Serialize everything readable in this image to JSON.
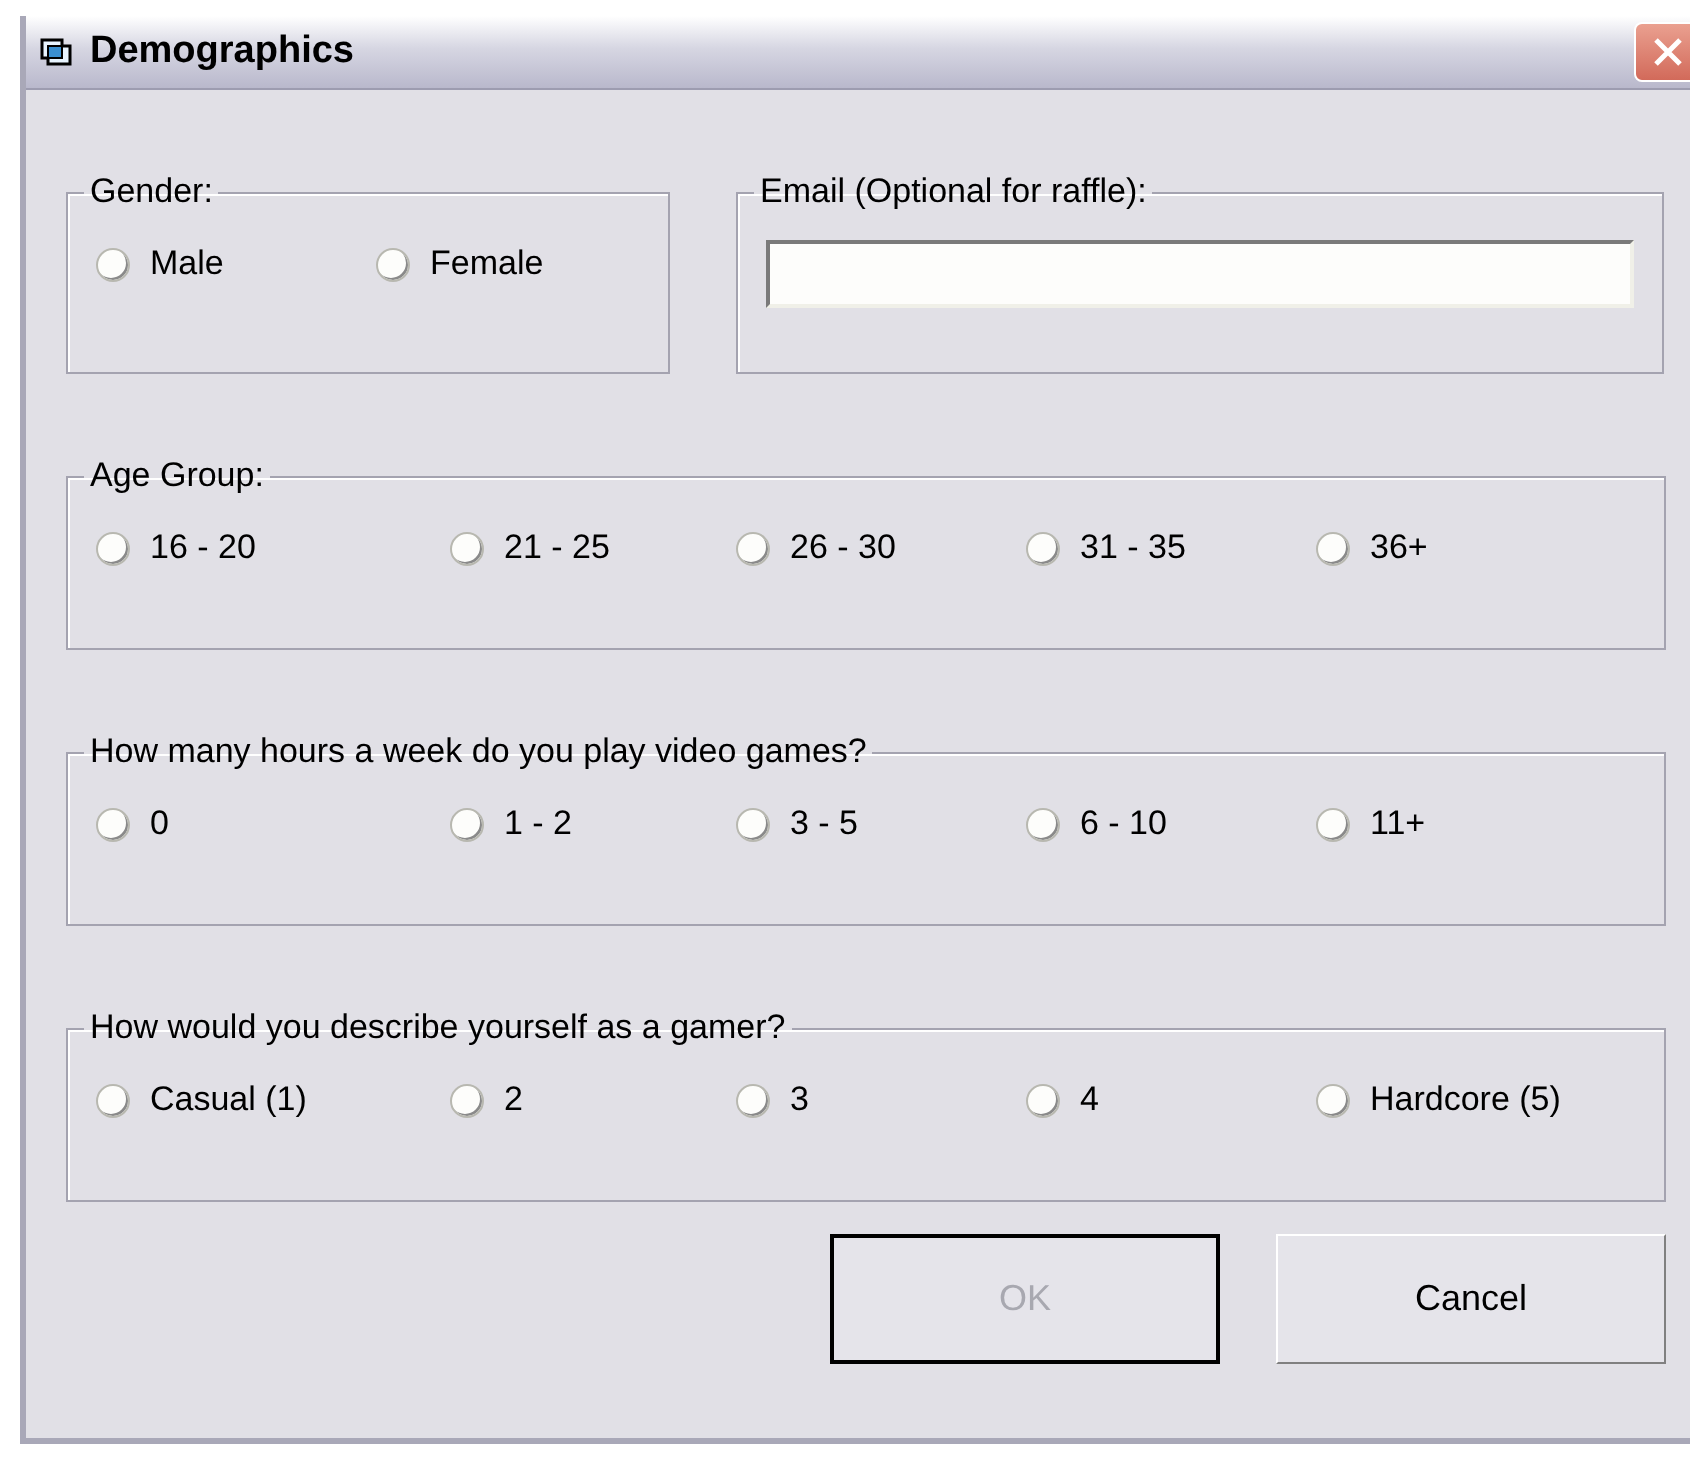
{
  "window": {
    "title": "Demographics"
  },
  "gender": {
    "label": "Gender:",
    "options": [
      {
        "label": "Male",
        "selected": false
      },
      {
        "label": "Female",
        "selected": false
      }
    ]
  },
  "email": {
    "label": "Email (Optional for raffle):"
  },
  "groups": [
    {
      "label": "Age Group:",
      "options": [
        {
          "label": "16 - 20",
          "selected": false
        },
        {
          "label": "21 - 25",
          "selected": false
        },
        {
          "label": "26 - 30",
          "selected": false
        },
        {
          "label": "31 - 35",
          "selected": false
        },
        {
          "label": "36+",
          "selected": false
        }
      ]
    },
    {
      "label": "How many hours a week do you play video games?",
      "options": [
        {
          "label": "0",
          "selected": false
        },
        {
          "label": "1 - 2",
          "selected": false
        },
        {
          "label": "3 - 5",
          "selected": false
        },
        {
          "label": "6 - 10",
          "selected": false
        },
        {
          "label": "11+",
          "selected": false
        }
      ]
    },
    {
      "label": "How would you describe yourself as a gamer?",
      "options": [
        {
          "label": "Casual (1)",
          "selected": false
        },
        {
          "label": "2",
          "selected": false
        },
        {
          "label": "3",
          "selected": false
        },
        {
          "label": "4",
          "selected": false
        },
        {
          "label": "Hardcore (5)",
          "selected": false
        }
      ]
    }
  ],
  "buttons": [
    {
      "label": "OK",
      "disabled": true,
      "default": true
    },
    {
      "label": "Cancel",
      "disabled": false,
      "default": false
    }
  ]
}
